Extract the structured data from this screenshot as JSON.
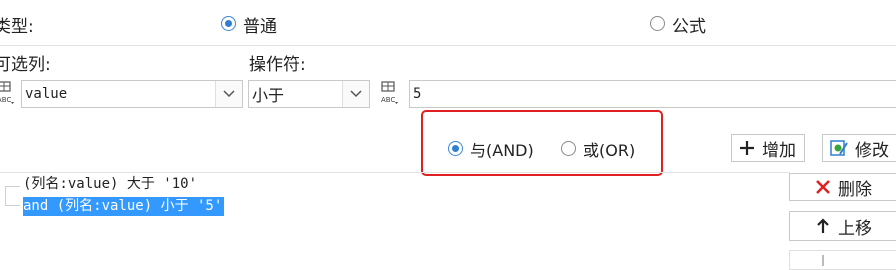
{
  "top_row": {
    "type_label": "类型:",
    "option_normal": "普通",
    "option_formula": "公式"
  },
  "field_labels": {
    "column_label": "可选列:",
    "operator_label": "操作符:"
  },
  "inputs": {
    "column_value": "value",
    "operator_value": "小于",
    "value_value": "5"
  },
  "logic": {
    "and_label": "与(AND)",
    "or_label": "或(OR)"
  },
  "buttons": {
    "add_label": "增加",
    "modify_label": "修改",
    "delete_label": "删除",
    "move_up_label": "上移"
  },
  "conditions": [
    "(列名:value) 大于 '10'",
    "and (列名:value) 小于 '5'"
  ],
  "colors": {
    "accent": "#2f7fd0",
    "selection": "#3399ff",
    "highlight_border": "#e02020",
    "delete_icon": "#e02020"
  }
}
